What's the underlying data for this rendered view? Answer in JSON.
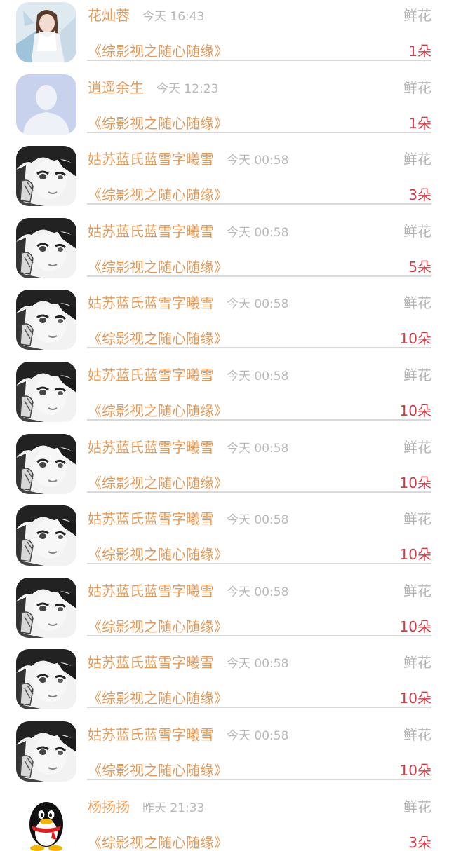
{
  "gift_rows": [
    {
      "avatar": "girl-illustration-avatar",
      "name": "花灿蓉",
      "time": "今天 16:43",
      "gift_type": "鲜花",
      "book": "《综影视之随心随缘》",
      "count": "1朵"
    },
    {
      "avatar": "default-person-avatar",
      "name": "逍遥余生",
      "time": "今天 12:23",
      "gift_type": "鲜花",
      "book": "《综影视之随心随缘》",
      "count": "1朵"
    },
    {
      "avatar": "manga-boy-avatar",
      "name": "姑苏蓝氏蓝雪字曦雪",
      "time": "今天 00:58",
      "gift_type": "鲜花",
      "book": "《综影视之随心随缘》",
      "count": "3朵"
    },
    {
      "avatar": "manga-boy-avatar",
      "name": "姑苏蓝氏蓝雪字曦雪",
      "time": "今天 00:58",
      "gift_type": "鲜花",
      "book": "《综影视之随心随缘》",
      "count": "5朵"
    },
    {
      "avatar": "manga-boy-avatar",
      "name": "姑苏蓝氏蓝雪字曦雪",
      "time": "今天 00:58",
      "gift_type": "鲜花",
      "book": "《综影视之随心随缘》",
      "count": "10朵"
    },
    {
      "avatar": "manga-boy-avatar",
      "name": "姑苏蓝氏蓝雪字曦雪",
      "time": "今天 00:58",
      "gift_type": "鲜花",
      "book": "《综影视之随心随缘》",
      "count": "10朵"
    },
    {
      "avatar": "manga-boy-avatar",
      "name": "姑苏蓝氏蓝雪字曦雪",
      "time": "今天 00:58",
      "gift_type": "鲜花",
      "book": "《综影视之随心随缘》",
      "count": "10朵"
    },
    {
      "avatar": "manga-boy-avatar",
      "name": "姑苏蓝氏蓝雪字曦雪",
      "time": "今天 00:58",
      "gift_type": "鲜花",
      "book": "《综影视之随心随缘》",
      "count": "10朵"
    },
    {
      "avatar": "manga-boy-avatar",
      "name": "姑苏蓝氏蓝雪字曦雪",
      "time": "今天 00:58",
      "gift_type": "鲜花",
      "book": "《综影视之随心随缘》",
      "count": "10朵"
    },
    {
      "avatar": "manga-boy-avatar",
      "name": "姑苏蓝氏蓝雪字曦雪",
      "time": "今天 00:58",
      "gift_type": "鲜花",
      "book": "《综影视之随心随缘》",
      "count": "10朵"
    },
    {
      "avatar": "manga-boy-avatar",
      "name": "姑苏蓝氏蓝雪字曦雪",
      "time": "今天 00:58",
      "gift_type": "鲜花",
      "book": "《综影视之随心随缘》",
      "count": "10朵"
    },
    {
      "avatar": "qq-penguin-avatar",
      "name": "杨扬扬",
      "time": "昨天 21:33",
      "gift_type": "鲜花",
      "book": "《综影视之随心随缘》",
      "count": "3朵"
    }
  ],
  "colors": {
    "name": "#e59a57",
    "time": "#b8b8b8",
    "gift_type": "#b5b5b5",
    "count": "#d13b45",
    "divider": "#d9d9d9"
  }
}
